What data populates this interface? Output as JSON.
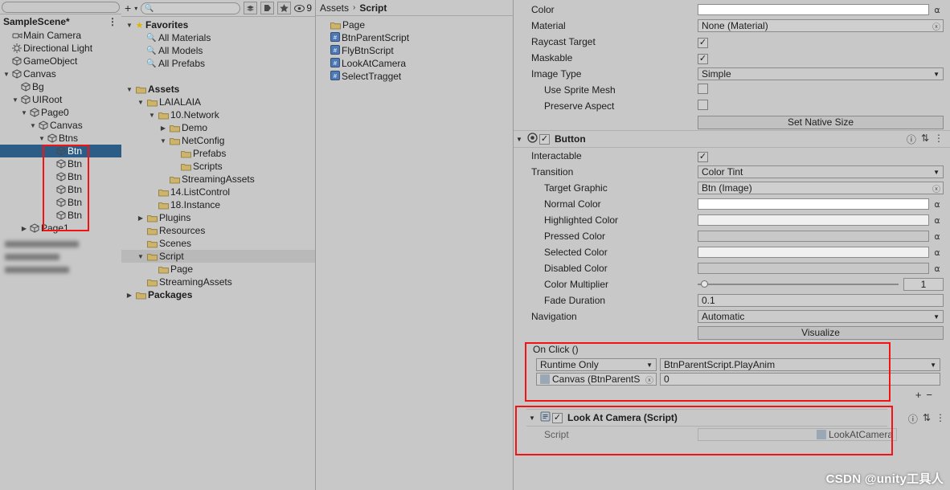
{
  "hierarchy": {
    "search_placeholder": "",
    "scene_name": "SampleScene*",
    "menu_dots": "⋮",
    "items": [
      {
        "label": "Main Camera",
        "depth": 0,
        "arrow": "",
        "icon": "camera-icon"
      },
      {
        "label": "Directional Light",
        "depth": 0,
        "arrow": "",
        "icon": "light-icon"
      },
      {
        "label": "GameObject",
        "depth": 0,
        "arrow": "",
        "icon": "gameobject-icon"
      },
      {
        "label": "Canvas",
        "depth": 0,
        "arrow": "▼",
        "icon": "canvas-icon"
      },
      {
        "label": "Bg",
        "depth": 1,
        "arrow": "",
        "icon": "gameobject-icon"
      },
      {
        "label": "UIRoot",
        "depth": 1,
        "arrow": "▼",
        "icon": "gameobject-icon"
      },
      {
        "label": "Page0",
        "depth": 2,
        "arrow": "▼",
        "icon": "gameobject-icon"
      },
      {
        "label": "Canvas",
        "depth": 3,
        "arrow": "▼",
        "icon": "gameobject-icon"
      },
      {
        "label": "Btns",
        "depth": 4,
        "arrow": "▼",
        "icon": "gameobject-icon"
      },
      {
        "label": "Btn",
        "depth": 5,
        "arrow": "",
        "icon": "gameobject-icon",
        "selected": true
      },
      {
        "label": "Btn",
        "depth": 5,
        "arrow": "",
        "icon": "gameobject-icon"
      },
      {
        "label": "Btn",
        "depth": 5,
        "arrow": "",
        "icon": "gameobject-icon"
      },
      {
        "label": "Btn",
        "depth": 5,
        "arrow": "",
        "icon": "gameobject-icon"
      },
      {
        "label": "Btn",
        "depth": 5,
        "arrow": "",
        "icon": "gameobject-icon"
      },
      {
        "label": "Btn",
        "depth": 5,
        "arrow": "",
        "icon": "gameobject-icon"
      },
      {
        "label": "Page1",
        "depth": 2,
        "arrow": "▶",
        "icon": "gameobject-icon"
      }
    ],
    "blurred_rows": 3
  },
  "project": {
    "search_placeholder": "",
    "toolbar": {
      "plus": "+",
      "caret": "▾",
      "icons": [
        "layers-icon",
        "tag-icon",
        "star-icon"
      ],
      "count_icon": "eye-icon",
      "count": "9"
    },
    "tree": [
      {
        "label": "Favorites",
        "depth": 0,
        "arrow": "▼",
        "icon": "star-icon",
        "bold": true
      },
      {
        "label": "All Materials",
        "depth": 1,
        "arrow": "",
        "icon": "search-icon"
      },
      {
        "label": "All Models",
        "depth": 1,
        "arrow": "",
        "icon": "search-icon"
      },
      {
        "label": "All Prefabs",
        "depth": 1,
        "arrow": "",
        "icon": "search-icon"
      },
      {
        "label": "",
        "depth": 0,
        "arrow": "",
        "icon": "spacer"
      },
      {
        "label": "Assets",
        "depth": 0,
        "arrow": "▼",
        "icon": "folder-icon",
        "bold": true
      },
      {
        "label": "LAIALAIA",
        "depth": 1,
        "arrow": "▼",
        "icon": "folder-icon"
      },
      {
        "label": "10.Network",
        "depth": 2,
        "arrow": "▼",
        "icon": "folder-icon"
      },
      {
        "label": "Demo",
        "depth": 3,
        "arrow": "▶",
        "icon": "folder-icon"
      },
      {
        "label": "NetConfig",
        "depth": 3,
        "arrow": "▼",
        "icon": "folder-icon"
      },
      {
        "label": "Prefabs",
        "depth": 4,
        "arrow": "",
        "icon": "folder-icon"
      },
      {
        "label": "Scripts",
        "depth": 4,
        "arrow": "",
        "icon": "folder-icon"
      },
      {
        "label": "StreamingAssets",
        "depth": 3,
        "arrow": "",
        "icon": "folder-icon"
      },
      {
        "label": "14.ListControl",
        "depth": 2,
        "arrow": "",
        "icon": "folder-icon"
      },
      {
        "label": "18.Instance",
        "depth": 2,
        "arrow": "",
        "icon": "folder-icon"
      },
      {
        "label": "Plugins",
        "depth": 1,
        "arrow": "▶",
        "icon": "folder-icon"
      },
      {
        "label": "Resources",
        "depth": 1,
        "arrow": "",
        "icon": "folder-icon"
      },
      {
        "label": "Scenes",
        "depth": 1,
        "arrow": "",
        "icon": "folder-icon"
      },
      {
        "label": "Script",
        "depth": 1,
        "arrow": "▼",
        "icon": "folder-icon",
        "highlighted": true
      },
      {
        "label": "Page",
        "depth": 2,
        "arrow": "",
        "icon": "folder-icon"
      },
      {
        "label": "StreamingAssets",
        "depth": 1,
        "arrow": "",
        "icon": "folder-icon"
      },
      {
        "label": "Packages",
        "depth": 0,
        "arrow": "▶",
        "icon": "folder-icon",
        "bold": true
      }
    ]
  },
  "assets_panel": {
    "breadcrumb_root": "Assets",
    "breadcrumb_sep": "›",
    "breadcrumb_current": "Script",
    "items": [
      {
        "label": "Page",
        "icon": "folder-icon"
      },
      {
        "label": "BtnParentScript",
        "icon": "cs-script-icon"
      },
      {
        "label": "FlyBtnScript",
        "icon": "cs-script-icon"
      },
      {
        "label": "LookAtCamera",
        "icon": "cs-script-icon"
      },
      {
        "label": "SelectTragget",
        "icon": "cs-script-icon"
      }
    ]
  },
  "inspector": {
    "image_component": {
      "rows": [
        {
          "label": "Color",
          "type": "color",
          "value": "#ffffff"
        },
        {
          "label": "Material",
          "type": "object",
          "value": "None (Material)"
        },
        {
          "label": "Raycast Target",
          "type": "check",
          "value": true
        },
        {
          "label": "Maskable",
          "type": "check",
          "value": true
        },
        {
          "label": "Image Type",
          "type": "dropdown",
          "value": "Simple"
        },
        {
          "label": "Use Sprite Mesh",
          "type": "check",
          "value": false,
          "indent": true
        },
        {
          "label": "Preserve Aspect",
          "type": "check",
          "value": false,
          "indent": true
        }
      ],
      "set_native_size_button": "Set Native Size"
    },
    "button_component": {
      "title": "Button",
      "enabled": true,
      "header_icons": [
        "help-icon",
        "preset-icon",
        "menu-icon"
      ],
      "rows": [
        {
          "label": "Interactable",
          "type": "check",
          "value": true
        },
        {
          "label": "Transition",
          "type": "dropdown",
          "value": "Color Tint"
        },
        {
          "label": "Target Graphic",
          "type": "object",
          "value": "Btn (Image)",
          "indent": true
        },
        {
          "label": "Normal Color",
          "type": "color",
          "value": "#ffffff",
          "indent": true
        },
        {
          "label": "Highlighted Color",
          "type": "color",
          "value": "#f0f0f0",
          "indent": true
        },
        {
          "label": "Pressed Color",
          "type": "color",
          "value": "#c8c8c8",
          "indent": true
        },
        {
          "label": "Selected Color",
          "type": "color",
          "value": "#f0f0f0",
          "indent": true
        },
        {
          "label": "Disabled Color",
          "type": "color",
          "value": "#c8c8c8",
          "indent": true
        },
        {
          "label": "Color Multiplier",
          "type": "slider",
          "value": "1",
          "indent": true
        },
        {
          "label": "Fade Duration",
          "type": "text",
          "value": "0.1",
          "indent": true
        },
        {
          "label": "Navigation",
          "type": "dropdown",
          "value": "Automatic"
        }
      ],
      "visualize_button": "Visualize"
    },
    "on_click": {
      "title": "On Click ()",
      "entry": {
        "mode": "Runtime Only",
        "function": "BtnParentScript.PlayAnim",
        "object": "Canvas (BtnParentS",
        "argument": "0"
      },
      "add_button": "+",
      "remove_button": "−"
    },
    "look_at_camera": {
      "title": "Look At Camera (Script)",
      "enabled": true,
      "rows": [
        {
          "label": "Script",
          "type": "object",
          "value": "LookAtCamera"
        }
      ]
    },
    "watermark": "CSDN @unity工具人"
  },
  "colors": {
    "selection_blue": "#2c5d87",
    "highlight_red": "#f01414",
    "panel_bg": "#c8c8c8"
  }
}
